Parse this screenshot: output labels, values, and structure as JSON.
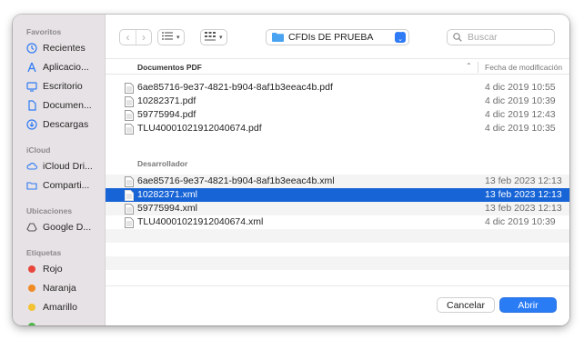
{
  "sidebar": {
    "favoritos_label": "Favoritos",
    "favoritos": [
      {
        "label": "Recientes",
        "icon": "clock-icon"
      },
      {
        "label": "Aplicacio...",
        "icon": "apps-icon"
      },
      {
        "label": "Escritorio",
        "icon": "desktop-icon"
      },
      {
        "label": "Documen...",
        "icon": "document-icon"
      },
      {
        "label": "Descargas",
        "icon": "download-icon"
      }
    ],
    "icloud_label": "iCloud",
    "icloud": [
      {
        "label": "iCloud Dri...",
        "icon": "cloud-icon"
      },
      {
        "label": "Comparti...",
        "icon": "shared-folder-icon"
      }
    ],
    "ubicaciones_label": "Ubicaciones",
    "ubicaciones": [
      {
        "label": "Google D...",
        "icon": "drive-icon"
      }
    ],
    "etiquetas_label": "Etiquetas",
    "etiquetas": [
      {
        "label": "Rojo",
        "color": "#e8453c"
      },
      {
        "label": "Naranja",
        "color": "#f08a24"
      },
      {
        "label": "Amarillo",
        "color": "#f2c232"
      }
    ],
    "partial_tag_color": "#4cb848"
  },
  "toolbar": {
    "location": "CFDIs DE PRUEBA",
    "search_placeholder": "Buscar"
  },
  "list": {
    "header_name": "Documentos PDF",
    "header_date": "Fecha de modificación",
    "pdf_files": [
      {
        "name": "6ae85716-9e37-4821-b904-8af1b3eeac4b.pdf",
        "date": "4 dic 2019 10:55"
      },
      {
        "name": "10282371.pdf",
        "date": "4 dic 2019 10:39"
      },
      {
        "name": "59775994.pdf",
        "date": "4 dic 2019 12:43"
      },
      {
        "name": "TLU40001021912040674.pdf",
        "date": "4 dic 2019 10:35"
      }
    ],
    "group2_label": "Desarrollador",
    "xml_files": [
      {
        "name": "6ae85716-9e37-4821-b904-8af1b3eeac4b.xml",
        "date": "13 feb 2023 12:13"
      },
      {
        "name": "10282371.xml",
        "date": "13 feb 2023 12:13",
        "selected": true
      },
      {
        "name": "59775994.xml",
        "date": "13 feb 2023 12:13"
      },
      {
        "name": "TLU40001021912040674.xml",
        "date": "4 dic 2019 10:39"
      }
    ]
  },
  "footer": {
    "cancel": "Cancelar",
    "open": "Abrir"
  },
  "colors": {
    "selection": "#1764d6",
    "accent": "#2a7cf5",
    "sidebar_bg": "#e7e2e5"
  }
}
